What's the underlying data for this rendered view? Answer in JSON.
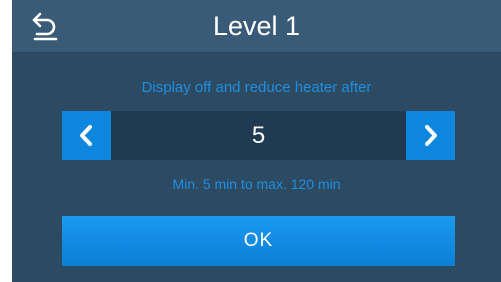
{
  "header": {
    "back_icon": "back-arrow-icon",
    "title": "Level 1"
  },
  "setting": {
    "prompt": "Display off and reduce heater after",
    "value": "5",
    "decrease_icon": "chevron-left-icon",
    "increase_icon": "chevron-right-icon",
    "range_hint": "Min. 5 min to max. 120 min"
  },
  "actions": {
    "ok_label": "OK"
  },
  "colors": {
    "background": "#2d4a63",
    "header": "#3a5b78",
    "accent": "#0d86dd",
    "accent_text": "#1e8fe0",
    "value_field": "#1f3a51"
  }
}
